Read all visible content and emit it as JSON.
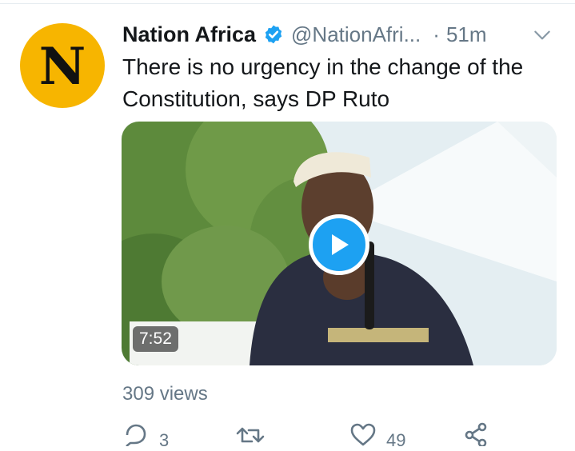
{
  "tweet": {
    "avatar_letter": "N",
    "display_name": "Nation Africa",
    "handle": "@NationAfri...",
    "separator": "·",
    "time": "51m",
    "text": "There is no urgency in the change of the Constitution, says DP Ruto",
    "video": {
      "duration": "7:52"
    },
    "views": "309 views",
    "replies": "3",
    "likes": "49"
  },
  "icons": {
    "verified": "verified-badge-icon",
    "caret": "chevron-down-icon",
    "play": "play-icon",
    "reply": "reply-icon",
    "retweet": "retweet-icon",
    "like": "heart-icon",
    "share": "share-icon"
  },
  "colors": {
    "brand_blue": "#1da1f2",
    "avatar_bg": "#f7b500",
    "secondary_text": "#657786"
  }
}
